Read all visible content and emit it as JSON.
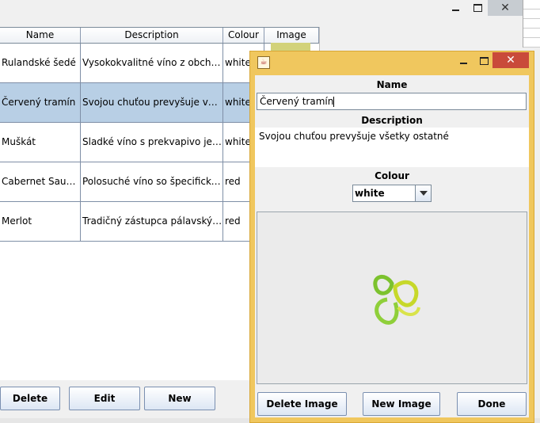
{
  "table": {
    "columns": [
      "Name",
      "Description",
      "Colour",
      "Image"
    ],
    "rows": [
      {
        "name": "Rulandské šedé",
        "description": "Vysokokvalitné víno z obchodu.",
        "colour": "white"
      },
      {
        "name": "Červený tramín",
        "description": "Svojou chuťou prevyšuje všetk...",
        "colour": "white"
      },
      {
        "name": "Muškát",
        "description": "Sladké víno s prekvapivo jemn...",
        "colour": "white"
      },
      {
        "name": "Cabernet Sauvi...",
        "description": "Polosuché víno so špecifickou...",
        "colour": "red"
      },
      {
        "name": "Merlot",
        "description": "Tradičný zástupca pálavských ...",
        "colour": "red"
      }
    ],
    "selected_row": 1
  },
  "main_buttons": {
    "delete": "Delete",
    "edit": "Edit",
    "new": "New"
  },
  "dialog": {
    "name_label": "Name",
    "name_value": "Červený tramín",
    "description_label": "Description",
    "description_value": "Svojou chuťou prevyšuje všetky ostatné",
    "colour_label": "Colour",
    "colour_value": "white",
    "buttons": {
      "delete_image": "Delete Image",
      "new_image": "New Image",
      "done": "Done"
    }
  },
  "colors": {
    "dialog_frame": "#f0c75e",
    "selected_row": "#b8cfe5",
    "close_button": "#c94a3a"
  }
}
